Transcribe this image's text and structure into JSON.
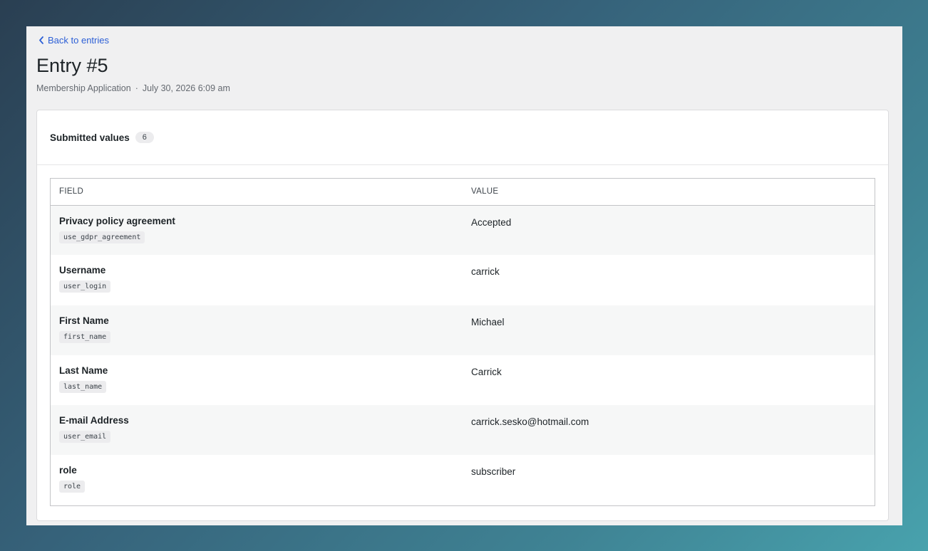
{
  "nav": {
    "back_label": "Back to entries"
  },
  "header": {
    "title": "Entry #5",
    "form_name": "Membership Application",
    "separator": "·",
    "timestamp": "July 30, 2026 6:09 am"
  },
  "card": {
    "title": "Submitted values",
    "count": "6"
  },
  "table": {
    "columns": [
      "FIELD",
      "VALUE"
    ],
    "rows": [
      {
        "label": "Privacy policy agreement",
        "key": "use_gdpr_agreement",
        "value": "Accepted"
      },
      {
        "label": "Username",
        "key": "user_login",
        "value": "carrick"
      },
      {
        "label": "First Name",
        "key": "first_name",
        "value": "Michael"
      },
      {
        "label": "Last Name",
        "key": "last_name",
        "value": "Carrick"
      },
      {
        "label": "E-mail Address",
        "key": "user_email",
        "value": "carrick.sesko@hotmail.com"
      },
      {
        "label": "role",
        "key": "role",
        "value": "subscriber"
      }
    ]
  },
  "icons": {
    "back": "chevron-left-icon"
  },
  "colors": {
    "link": "#2c5fd6",
    "page_bg": "#f0f0f1",
    "card_bg": "#ffffff"
  }
}
